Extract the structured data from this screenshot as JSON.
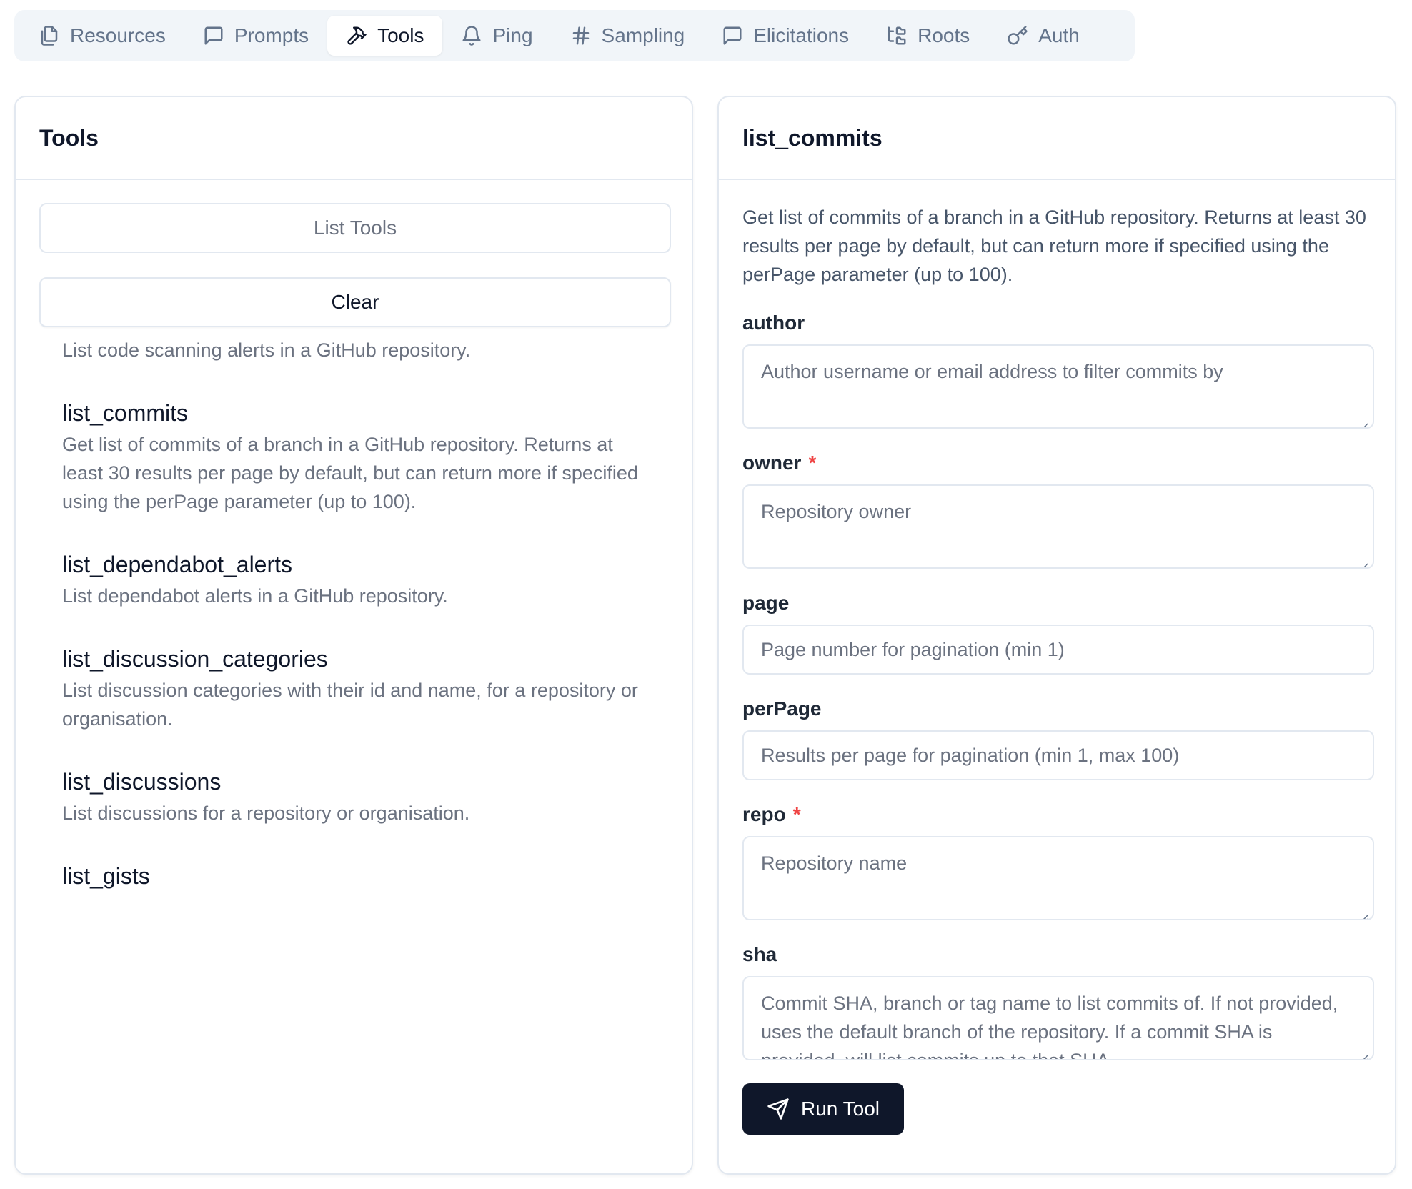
{
  "tabs": [
    {
      "label": "Resources",
      "icon": "files-icon",
      "active": false
    },
    {
      "label": "Prompts",
      "icon": "message-square-icon",
      "active": false
    },
    {
      "label": "Tools",
      "icon": "hammer-icon",
      "active": true
    },
    {
      "label": "Ping",
      "icon": "bell-icon",
      "active": false
    },
    {
      "label": "Sampling",
      "icon": "hash-icon",
      "active": false
    },
    {
      "label": "Elicitations",
      "icon": "message-square-icon",
      "active": false
    },
    {
      "label": "Roots",
      "icon": "folder-tree-icon",
      "active": false
    },
    {
      "label": "Auth",
      "icon": "key-icon",
      "active": false
    }
  ],
  "left": {
    "title": "Tools",
    "list_button": "List Tools",
    "clear_button": "Clear",
    "tools": [
      {
        "name": "",
        "desc": "List code scanning alerts in a GitHub repository."
      },
      {
        "name": "list_commits",
        "desc": "Get list of commits of a branch in a GitHub repository. Returns at least 30 results per page by default, but can return more if specified using the perPage parameter (up to 100)."
      },
      {
        "name": "list_dependabot_alerts",
        "desc": "List dependabot alerts in a GitHub repository."
      },
      {
        "name": "list_discussion_categories",
        "desc": "List discussion categories with their id and name, for a repository or organisation."
      },
      {
        "name": "list_discussions",
        "desc": "List discussions for a repository or organisation."
      },
      {
        "name": "list_gists",
        "desc": ""
      }
    ]
  },
  "right": {
    "title": "list_commits",
    "description": "Get list of commits of a branch in a GitHub repository. Returns at least 30 results per page by default, but can return more if specified using the perPage parameter (up to 100).",
    "fields": {
      "author": {
        "label": "author",
        "placeholder": "Author username or email address to filter commits by"
      },
      "owner": {
        "label": "owner",
        "required": "*",
        "placeholder": "Repository owner"
      },
      "page": {
        "label": "page",
        "placeholder": "Page number for pagination (min 1)"
      },
      "perPage": {
        "label": "perPage",
        "placeholder": "Results per page for pagination (min 1, max 100)"
      },
      "repo": {
        "label": "repo",
        "required": "*",
        "placeholder": "Repository name"
      },
      "sha": {
        "label": "sha",
        "placeholder": "Commit SHA, branch or tag name to list commits of. If not provided, uses the default branch of the repository. If a commit SHA is provided, will list commits up to that SHA."
      }
    },
    "run_button": "Run Tool"
  }
}
